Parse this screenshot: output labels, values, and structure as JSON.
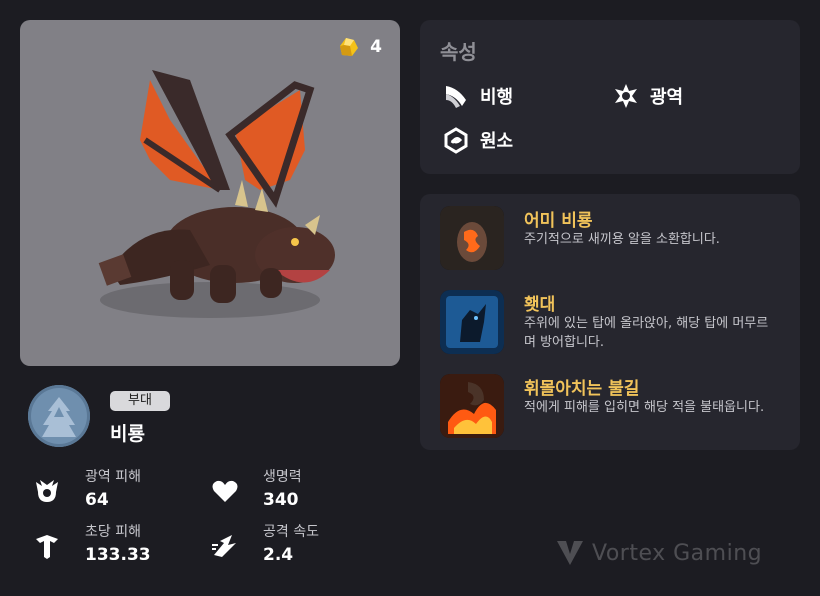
{
  "unit": {
    "cost": "4",
    "tag": "부대",
    "name": "비룡",
    "portrait_icon": "dragon-portrait",
    "cost_icon": "gold-ore-icon"
  },
  "stats": [
    {
      "label": "광역 피해",
      "value": "64",
      "icon": "area-damage-icon"
    },
    {
      "label": "생명력",
      "value": "340",
      "icon": "heart-icon"
    },
    {
      "label": "초당 피해",
      "value": "133.33",
      "icon": "dps-icon"
    },
    {
      "label": "공격 속도",
      "value": "2.4",
      "icon": "attack-speed-icon"
    }
  ],
  "attributes": {
    "title": "속성",
    "items": [
      {
        "label": "비행",
        "icon": "wing-icon"
      },
      {
        "label": "광역",
        "icon": "burst-icon"
      },
      {
        "label": "원소",
        "icon": "element-swirl-icon"
      }
    ]
  },
  "skills": [
    {
      "name": "어미 비룡",
      "desc": "주기적으로 새끼용 알을 소환합니다.",
      "icon": "egg-skill-icon"
    },
    {
      "name": "횃대",
      "desc": "주위에 있는 탑에 올라앉아, 해당 탑에 머무르며 방어합니다.",
      "icon": "perch-skill-icon"
    },
    {
      "name": "휘몰아치는 불길",
      "desc": "적에게 피해를 입히면 해당 적을 불태웁니다.",
      "icon": "fire-skill-icon"
    }
  ],
  "watermark": "Vortex Gaming",
  "colors": {
    "background": "#1c1c22",
    "card": "#26262e",
    "skill_name": "#f1c35a",
    "portrait_bg": "#818086"
  }
}
